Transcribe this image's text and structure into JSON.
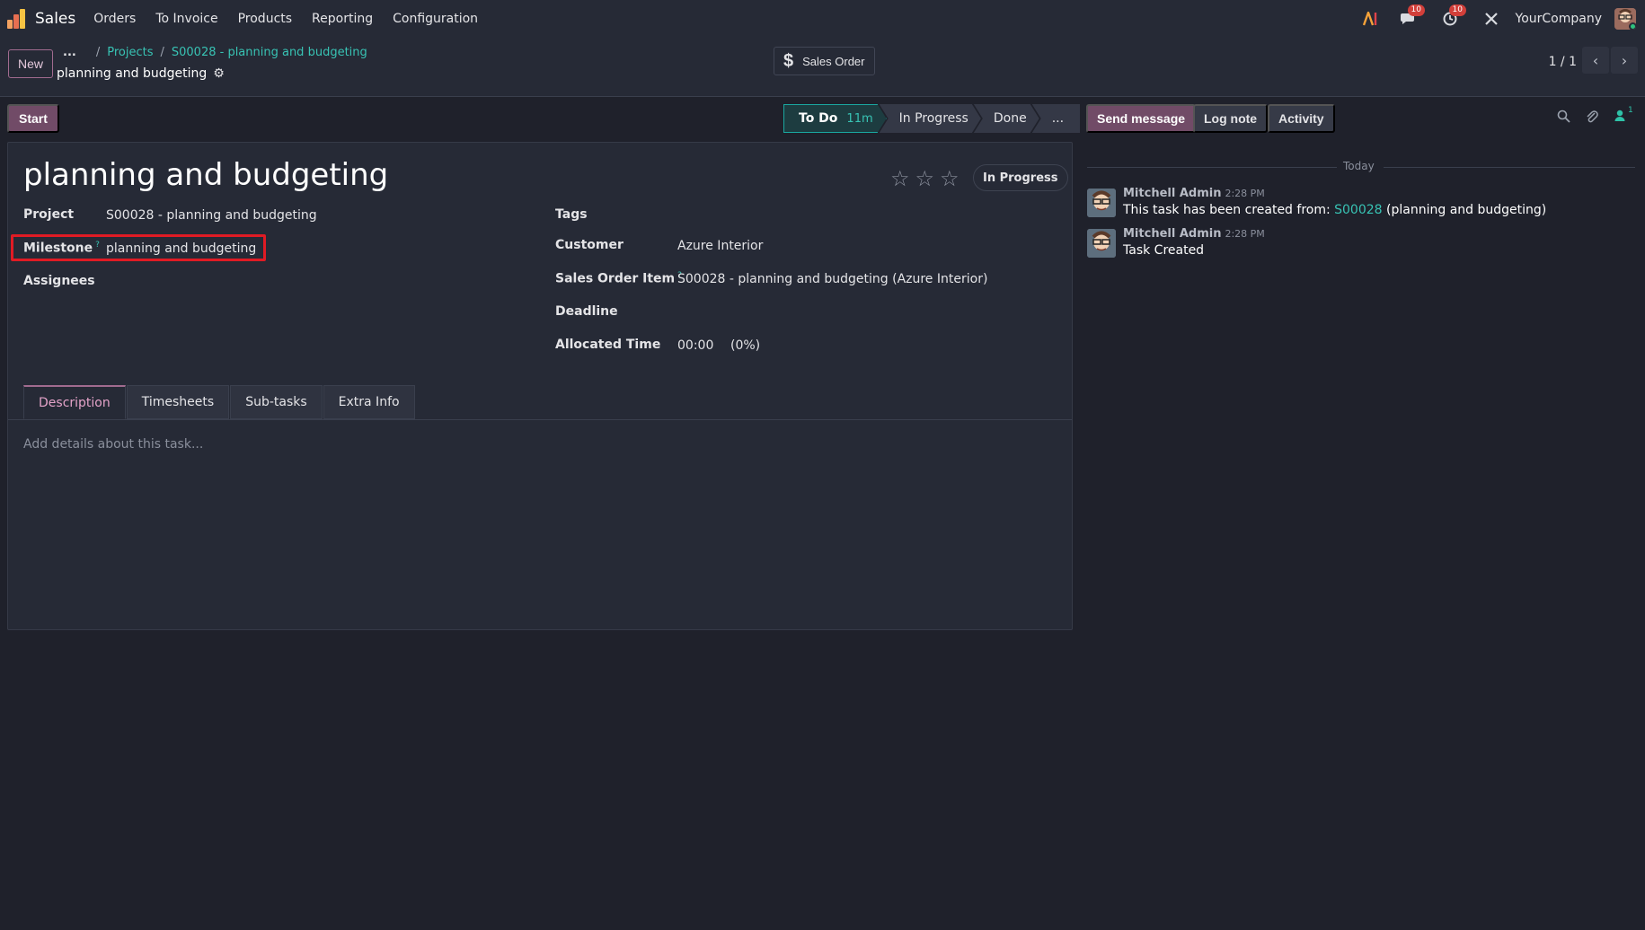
{
  "navbar": {
    "app_name": "Sales",
    "menu": [
      "Orders",
      "To Invoice",
      "Products",
      "Reporting",
      "Configuration"
    ],
    "messages_badge": "10",
    "activities_badge": "10",
    "company": "YourCompany"
  },
  "control": {
    "new_label": "New",
    "breadcrumb_dots": "...",
    "breadcrumb": [
      "Projects",
      "S00028 - planning and budgeting"
    ],
    "record_title": "planning and budgeting",
    "sales_order_label": "Sales Order",
    "pager": "1 / 1"
  },
  "statusbar": {
    "start_label": "Start",
    "stages": [
      {
        "label": "To Do",
        "duration": "11m"
      },
      {
        "label": "In Progress"
      },
      {
        "label": "Done"
      },
      {
        "label": "..."
      }
    ]
  },
  "form": {
    "title": "planning and budgeting",
    "state": "In Progress",
    "fields_left": {
      "project_label": "Project",
      "project_value": "S00028 - planning and budgeting",
      "milestone_label": "Milestone",
      "milestone_help": "?",
      "milestone_value": "planning and budgeting",
      "assignees_label": "Assignees"
    },
    "fields_right": {
      "tags_label": "Tags",
      "customer_label": "Customer",
      "customer_value": "Azure Interior",
      "soi_label": "Sales Order Item",
      "soi_help": "?",
      "soi_value": "S00028 - planning and budgeting (Azure Interior)",
      "deadline_label": "Deadline",
      "allocated_label": "Allocated Time",
      "allocated_value": "00:00",
      "allocated_pct": "(0%)"
    },
    "tabs": [
      "Description",
      "Timesheets",
      "Sub-tasks",
      "Extra Info"
    ],
    "description_placeholder": "Add details about this task..."
  },
  "chatter": {
    "send_message": "Send message",
    "log_note": "Log note",
    "activity": "Activity",
    "followers_count": "1",
    "day": "Today",
    "messages": [
      {
        "author": "Mitchell Admin",
        "time": "2:28 PM",
        "body_prefix": "This task has been created from: ",
        "body_link": "S00028",
        "body_suffix": " (planning and budgeting)"
      },
      {
        "author": "Mitchell Admin",
        "time": "2:28 PM",
        "body": "Task Created"
      }
    ]
  },
  "colors": {
    "accent": "#714b67",
    "link": "#38c3b4",
    "highlight": "#e01b24",
    "background": "#1f212b"
  }
}
